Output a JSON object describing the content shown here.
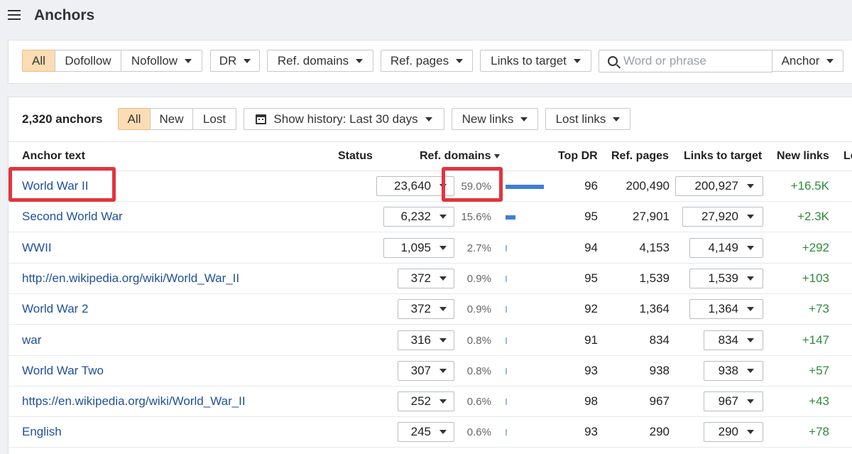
{
  "header": {
    "title": "Anchors",
    "menu_icon": "hamburger-icon"
  },
  "filters": {
    "type_all": "All",
    "type_dofollow": "Dofollow",
    "type_nofollow": "Nofollow",
    "dr": "DR",
    "ref_domains": "Ref. domains",
    "ref_pages": "Ref. pages",
    "links_to_target": "Links to target",
    "search_placeholder": "Word or phrase",
    "search_scope": "Anchor"
  },
  "toolbar": {
    "count": "2,320 anchors",
    "seg_all": "All",
    "seg_new": "New",
    "seg_lost": "Lost",
    "history": "Show history: Last 30 days",
    "new_links": "New links",
    "lost_links": "Lost links"
  },
  "columns": {
    "anchor_text": "Anchor text",
    "status": "Status",
    "ref_domains": "Ref. domains",
    "top_dr": "Top DR",
    "ref_pages": "Ref. pages",
    "links_to_target": "Links to target",
    "new_links": "New links",
    "lost_links_partial": "Lo"
  },
  "rows": [
    {
      "anchor": "World War II",
      "ref_domains": "23,640",
      "pct": "59.0%",
      "share": 0.59,
      "top_dr": "96",
      "ref_pages": "200,490",
      "links_to_target": "200,927",
      "new_links": "+16.5K"
    },
    {
      "anchor": "Second World War",
      "ref_domains": "6,232",
      "pct": "15.6%",
      "share": 0.156,
      "top_dr": "95",
      "ref_pages": "27,901",
      "links_to_target": "27,920",
      "new_links": "+2.3K"
    },
    {
      "anchor": "WWII",
      "ref_domains": "1,095",
      "pct": "2.7%",
      "share": 0.027,
      "top_dr": "94",
      "ref_pages": "4,153",
      "links_to_target": "4,149",
      "new_links": "+292"
    },
    {
      "anchor": "http://en.wikipedia.org/wiki/World_War_II",
      "ref_domains": "372",
      "pct": "0.9%",
      "share": 0.009,
      "top_dr": "95",
      "ref_pages": "1,539",
      "links_to_target": "1,539",
      "new_links": "+103"
    },
    {
      "anchor": "World War 2",
      "ref_domains": "372",
      "pct": "0.9%",
      "share": 0.009,
      "top_dr": "92",
      "ref_pages": "1,364",
      "links_to_target": "1,364",
      "new_links": "+73"
    },
    {
      "anchor": "war",
      "ref_domains": "316",
      "pct": "0.8%",
      "share": 0.008,
      "top_dr": "91",
      "ref_pages": "834",
      "links_to_target": "834",
      "new_links": "+147"
    },
    {
      "anchor": "World War Two",
      "ref_domains": "307",
      "pct": "0.8%",
      "share": 0.008,
      "top_dr": "93",
      "ref_pages": "938",
      "links_to_target": "938",
      "new_links": "+57"
    },
    {
      "anchor": "https://en.wikipedia.org/wiki/World_War_II",
      "ref_domains": "252",
      "pct": "0.6%",
      "share": 0.006,
      "top_dr": "98",
      "ref_pages": "967",
      "links_to_target": "967",
      "new_links": "+43"
    },
    {
      "anchor": "English",
      "ref_domains": "245",
      "pct": "0.6%",
      "share": 0.006,
      "top_dr": "93",
      "ref_pages": "290",
      "links_to_target": "290",
      "new_links": "+78"
    }
  ],
  "colors": {
    "active_bg": "#fbdcb4",
    "link": "#1f4f9d",
    "positive": "#2f8a3b",
    "bar": "#3e7fd4",
    "highlight": "#e2343d"
  }
}
